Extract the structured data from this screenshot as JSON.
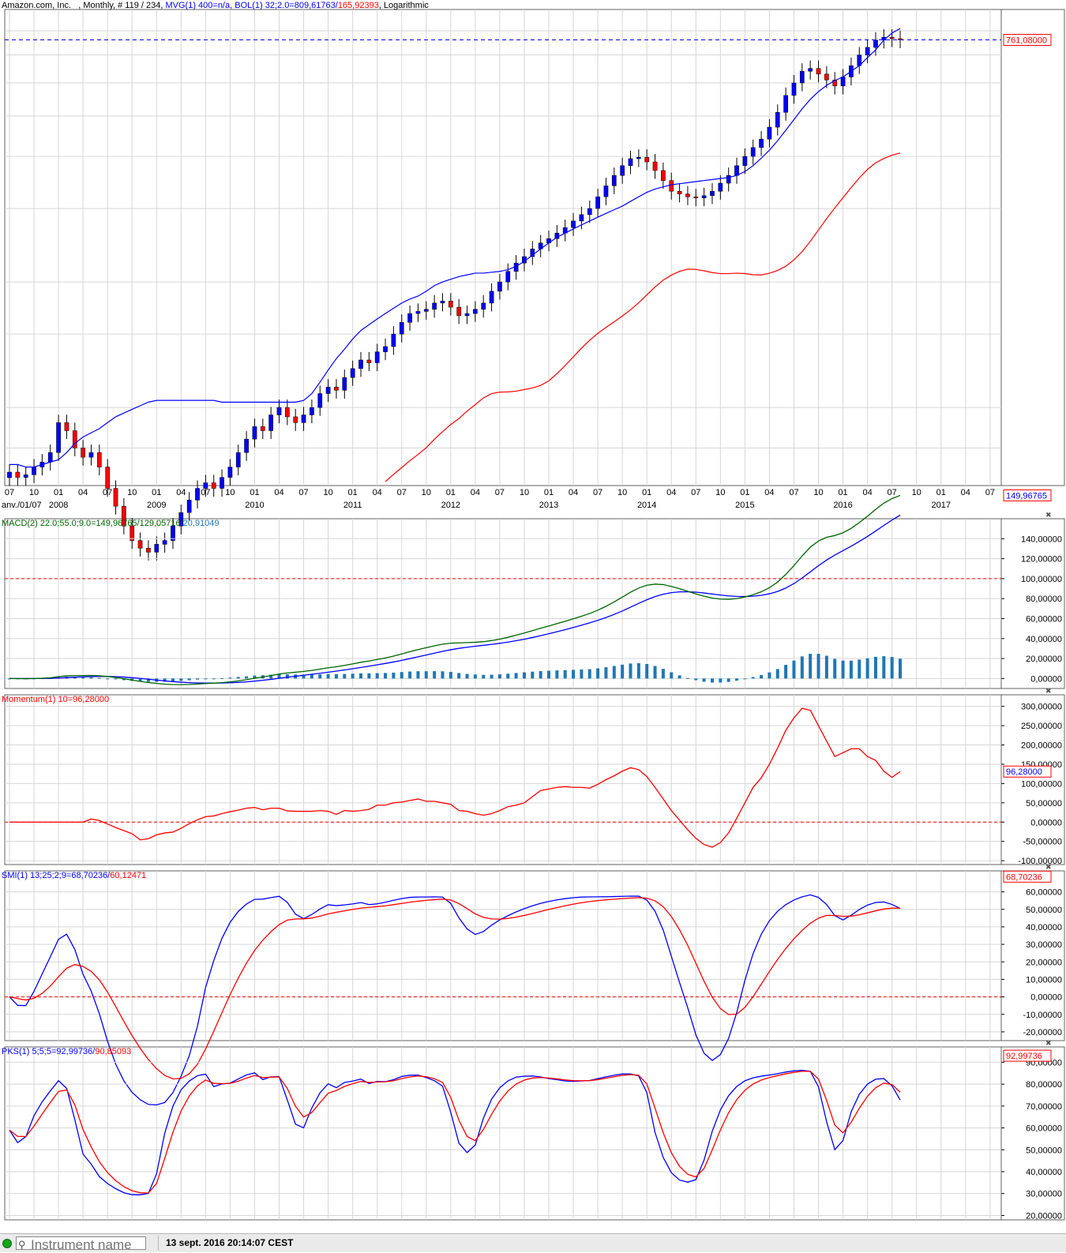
{
  "colors": {
    "blue": "#0000ff",
    "red": "#ff0000",
    "green": "#006400",
    "teal": "#1f77b4",
    "grid": "#d6d6d6"
  },
  "main_header": {
    "instrument": "Amazon.com, Inc.   , Monthly, # 119 / 234, ",
    "mvg": "MVG(1) 400=n/a, ",
    "bol_a": "BOL(1) 32;2.0=809,61763/",
    "bol_b": "165,92393",
    "log": ", Logarithmic"
  },
  "macd_header": {
    "a": "MACD(2) 22.0;55.0;9.0=149,96765/129,05716/",
    "b": "20,91049"
  },
  "mom_header": {
    "a": "Momentum(1) 10=96,28000"
  },
  "smi_header": {
    "a": "SMI(1) 13;25;2;9=68,70236/",
    "b": "60,12471"
  },
  "pks_header": {
    "a": "PKS(1) 5;5;5=92,99736/",
    "b": "90,85093"
  },
  "status": {
    "placeholder": "Instrument name",
    "datetime": "13 sept. 2016 20:14:07 CEST"
  },
  "chart_data": [
    {
      "type": "candlestick",
      "title": "Amazon.com, Inc. Monthly",
      "scale": "log",
      "y_min": 65,
      "y_max": 900,
      "start": "2007-07",
      "current_price": "761,08000",
      "x_ticks": [
        "01",
        "04",
        "07",
        "10",
        "01",
        "04",
        "07",
        "10",
        "01",
        "04",
        "07",
        "10",
        "01",
        "04",
        "07",
        "10",
        "01",
        "04",
        "07",
        "10",
        "01",
        "04",
        "07",
        "10",
        "01",
        "04",
        "07",
        "10",
        "01",
        "04",
        "07",
        "10",
        "01",
        "04",
        "07",
        "10",
        "01",
        "04",
        "07",
        "10",
        "01",
        "04",
        "07"
      ],
      "first_tick_index": -6,
      "x_tick_step": 3,
      "year_labels": [
        {
          "label": "anv./01/07",
          "at": -6
        },
        {
          "label": "2008",
          "at": 6
        },
        {
          "label": "2009",
          "at": 18
        },
        {
          "label": "2010",
          "at": 30
        },
        {
          "label": "2011",
          "at": 42
        },
        {
          "label": "2012",
          "at": 54
        },
        {
          "label": "2013",
          "at": 66
        },
        {
          "label": "2014",
          "at": 78
        },
        {
          "label": "2015",
          "at": 90
        },
        {
          "label": "2016",
          "at": 102
        },
        {
          "label": "2017",
          "at": 114
        }
      ],
      "close": [
        70,
        68,
        69,
        72,
        74,
        78,
        92,
        88,
        80,
        76,
        78,
        72,
        64,
        58,
        52,
        48,
        46,
        45,
        47,
        48,
        52,
        56,
        60,
        64,
        66,
        64,
        68,
        72,
        78,
        84,
        90,
        88,
        96,
        100,
        95,
        92,
        96,
        100,
        108,
        112,
        110,
        118,
        124,
        130,
        128,
        136,
        140,
        150,
        160,
        168,
        170,
        172,
        178,
        180,
        174,
        166,
        168,
        172,
        178,
        190,
        200,
        212,
        222,
        230,
        240,
        248,
        254,
        262,
        270,
        280,
        290,
        300,
        320,
        340,
        360,
        380,
        395,
        398,
        388,
        370,
        350,
        330,
        325,
        320,
        318,
        322,
        330,
        345,
        360,
        380,
        400,
        420,
        440,
        470,
        510,
        560,
        600,
        640,
        650,
        630,
        610,
        590,
        620,
        660,
        700,
        730,
        760,
        772,
        766,
        761
      ],
      "bol_upper": [
        73,
        73,
        72,
        72,
        73,
        74,
        75,
        78,
        82,
        85,
        87,
        89,
        92,
        95,
        97,
        99,
        101,
        103,
        104,
        104,
        104,
        104,
        104,
        104,
        104,
        104,
        103,
        103,
        103,
        103,
        103,
        103,
        103,
        103,
        103,
        103,
        104,
        108,
        115,
        123,
        131,
        138,
        146,
        153,
        158,
        163,
        168,
        173,
        178,
        182,
        185,
        190,
        196,
        200,
        203,
        206,
        208,
        210,
        210,
        211,
        212,
        214,
        218,
        224,
        232,
        240,
        248,
        256,
        262,
        268,
        274,
        280,
        286,
        292,
        298,
        304,
        312,
        320,
        328,
        334,
        338,
        342,
        344,
        346,
        348,
        350,
        352,
        354,
        356,
        360,
        368,
        380,
        396,
        414,
        436,
        462,
        490,
        520,
        548,
        572,
        592,
        608,
        620,
        640,
        660,
        690,
        720,
        760,
        790,
        810
      ]
    },
    {
      "type": "line",
      "title": "MACD",
      "y_min": -10,
      "y_max": 160,
      "y_ticks": [
        0,
        20,
        40,
        60,
        80,
        100,
        120,
        140
      ],
      "ref": 100
    },
    {
      "type": "line",
      "title": "Momentum",
      "y_min": -110,
      "y_max": 330,
      "y_ticks": [
        -100,
        -50,
        0,
        50,
        100,
        150,
        200,
        250,
        300
      ],
      "ref": 0,
      "last": "96,28000"
    },
    {
      "type": "line",
      "title": "SMI",
      "y_min": -25,
      "y_max": 72,
      "y_ticks": [
        -20,
        -10,
        0,
        10,
        20,
        30,
        40,
        50,
        60
      ],
      "ref": 0,
      "last": "68,70236"
    },
    {
      "type": "line",
      "title": "PKS",
      "y_min": 18,
      "y_max": 97,
      "y_ticks": [
        20,
        30,
        40,
        50,
        60,
        70,
        80,
        90
      ],
      "last": "92,99736"
    }
  ]
}
